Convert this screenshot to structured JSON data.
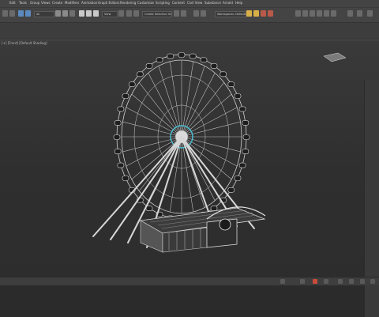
{
  "menu": {
    "items": [
      "Edit",
      "Tools",
      "Group",
      "Views",
      "Create",
      "Modifiers",
      "Animation",
      "Graph Editors",
      "Rendering",
      "Customize",
      "Scripting",
      "Content",
      "Civil View",
      "Substance",
      "Arnold",
      "Help"
    ]
  },
  "toolbar": {
    "selection_filter": "All",
    "view_dropdown": "View",
    "named_selection": "Create Selection Se",
    "workspace": "Workspaces: Default"
  },
  "viewport": {
    "label": "[+] [Front] [Default Shading]"
  },
  "colors": {
    "accent": "#4bc3d6",
    "background": "#2b2b2b"
  }
}
